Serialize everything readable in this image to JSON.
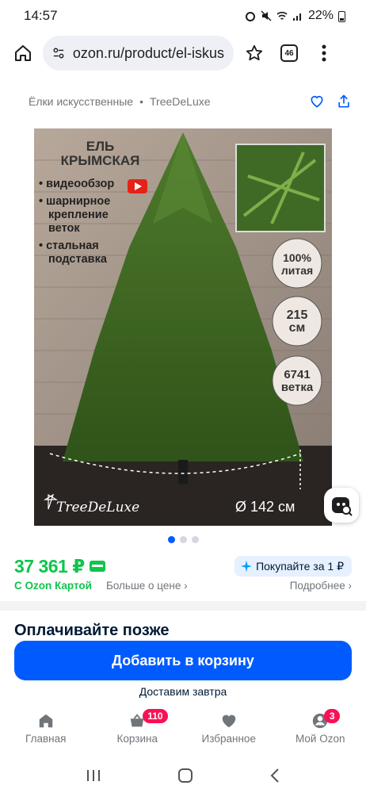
{
  "status_bar": {
    "time": "14:57",
    "battery": "22%"
  },
  "browser": {
    "url": "ozon.ru/product/el-iskus",
    "tab_count": "46"
  },
  "breadcrumb": {
    "category": "Ёлки искусственные",
    "brand": "TreeDeLuxe"
  },
  "product_image": {
    "title_line1": "ЕЛЬ",
    "title_line2": "КРЫМСКАЯ",
    "features": [
      "видеообзор",
      "шарнирное",
      "крепление",
      "веток",
      "стальная",
      "подставка"
    ],
    "badges": [
      {
        "line1": "100%",
        "line2": "литая"
      },
      {
        "line1": "215",
        "line2": "см"
      },
      {
        "line1": "6741",
        "line2": "ветка"
      }
    ],
    "diameter": "Ø 142 см",
    "logo": "TreeDeLuxe",
    "slide_count": 3,
    "active_slide": 0
  },
  "pricing": {
    "price": "37 361 ₽",
    "ozon_card_label": "С Ozon Картой",
    "more_about_price": "Больше о цене",
    "promo": "Покупайте за 1 ₽",
    "details_link": "Подробнее"
  },
  "section_title": "Оплачивайте позже",
  "cta": {
    "add_to_cart": "Добавить в корзину",
    "delivery": "Доставим завтра"
  },
  "bottom_nav": [
    {
      "label": "Главная",
      "icon": "home-icon"
    },
    {
      "label": "Корзина",
      "icon": "cart-icon",
      "badge": "110"
    },
    {
      "label": "Избранное",
      "icon": "heart-icon"
    },
    {
      "label": "Мой Ozon",
      "icon": "profile-icon",
      "badge": "3"
    }
  ],
  "colors": {
    "accent": "#005bff",
    "price_green": "#10c44c",
    "badge_pink": "#f91155"
  }
}
